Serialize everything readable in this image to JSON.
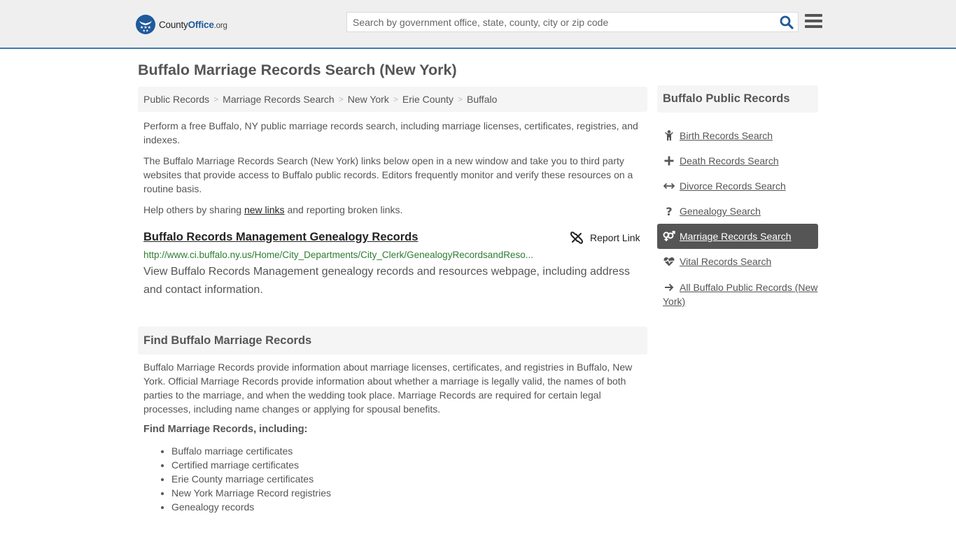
{
  "header": {
    "logo": {
      "name_part1": "County",
      "name_part2": "Office",
      "name_part3": ".org"
    },
    "search": {
      "placeholder": "Search by government office, state, county, city or zip code",
      "value": ""
    }
  },
  "page": {
    "title": "Buffalo Marriage Records Search (New York)"
  },
  "breadcrumb": [
    {
      "label": "Public Records"
    },
    {
      "label": "Marriage Records Search"
    },
    {
      "label": "New York"
    },
    {
      "label": "Erie County"
    },
    {
      "label": "Buffalo"
    }
  ],
  "intro": {
    "p1": "Perform a free Buffalo, NY public marriage records search, including marriage licenses, certificates, registries, and indexes.",
    "p2": "The Buffalo Marriage Records Search (New York) links below open in a new window and take you to third party websites that provide access to Buffalo public records. Editors frequently monitor and verify these resources on a routine basis.",
    "p3_before": "Help others by sharing ",
    "p3_link": "new links",
    "p3_after": " and reporting broken links."
  },
  "result": {
    "title": "Buffalo Records Management Genealogy Records",
    "report_label": "Report Link",
    "url": "http://www.ci.buffalo.ny.us/Home/City_Departments/City_Clerk/GenealogyRecordsandReso...",
    "description": "View Buffalo Records Management genealogy records and resources webpage, including address and contact information."
  },
  "find_section": {
    "heading": "Find Buffalo Marriage Records",
    "body": "Buffalo Marriage Records provide information about marriage licenses, certificates, and registries in Buffalo, New York. Official Marriage Records provide information about whether a marriage is legally valid, the names of both parties to the marriage, and when the wedding took place. Marriage Records are required for certain legal processes, including name changes or applying for spousal benefits.",
    "subheading": "Find Marriage Records, including:",
    "items": [
      "Buffalo marriage certificates",
      "Certified marriage certificates",
      "Erie County marriage certificates",
      "New York Marriage Record registries",
      "Genealogy records"
    ]
  },
  "sidebar": {
    "heading": "Buffalo Public Records",
    "items": [
      {
        "label": "Birth Records Search",
        "icon": "child-icon",
        "active": false
      },
      {
        "label": "Death Records Search",
        "icon": "plus-icon",
        "active": false
      },
      {
        "label": "Divorce Records Search",
        "icon": "arrows-horizontal-icon",
        "active": false
      },
      {
        "label": "Genealogy Search",
        "icon": "question-icon",
        "active": false
      },
      {
        "label": "Marriage Records Search",
        "icon": "venus-mars-icon",
        "active": true
      },
      {
        "label": "Vital Records Search",
        "icon": "heartbeat-icon",
        "active": false
      },
      {
        "label": "All Buffalo Public Records (New York)",
        "icon": "arrow-right-icon",
        "active": false
      }
    ]
  },
  "colors": {
    "brand_blue": "#1f5a9c",
    "header_border": "#3a7cad",
    "url_green": "#2e7d32",
    "active_item_bg": "#555555",
    "panel_bg": "#f5f5f5"
  }
}
